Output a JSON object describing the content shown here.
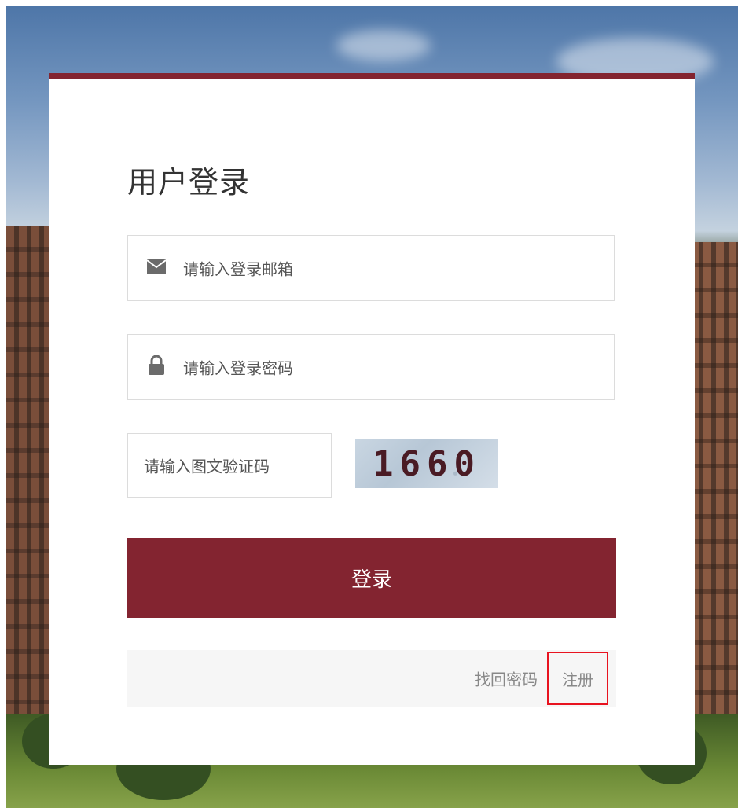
{
  "login": {
    "title": "用户登录",
    "email_placeholder": "请输入登录邮箱",
    "password_placeholder": "请输入登录密码",
    "captcha_placeholder": "请输入图文验证码",
    "captcha_code": "1660",
    "submit_label": "登录",
    "forgot_password_label": "找回密码",
    "register_label": "注册"
  },
  "colors": {
    "accent": "#832430",
    "highlight_border": "#e8131f"
  },
  "icons": {
    "email": "envelope-icon",
    "password": "lock-icon"
  }
}
